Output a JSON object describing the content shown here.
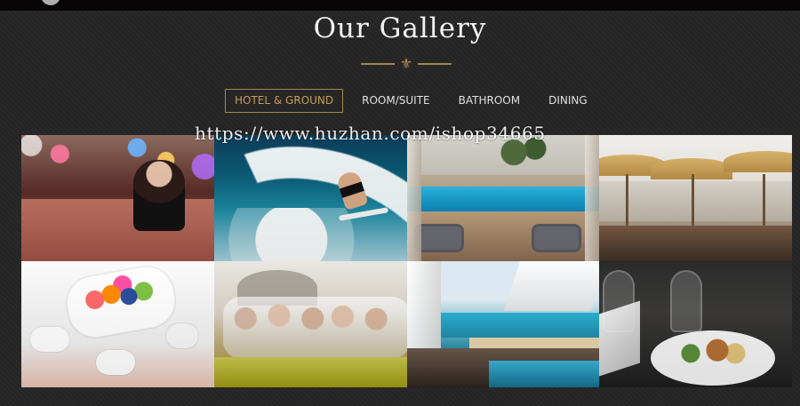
{
  "page": {
    "title": "Our Gallery",
    "watermark": "https://www.huzhan.com/ishop34665"
  },
  "gallery": {
    "tabs": [
      {
        "label": "HOTEL & GROUND",
        "active": true
      },
      {
        "label": "ROOM/SUITE",
        "active": false
      },
      {
        "label": "BATHROOM",
        "active": false
      },
      {
        "label": "DINING",
        "active": false
      }
    ],
    "accent_color": "#a7864d",
    "images": [
      {
        "name": "concert-crowd-photo"
      },
      {
        "name": "surfer-wave-photo"
      },
      {
        "name": "hotel-pool-photo"
      },
      {
        "name": "beach-umbrellas-dining-photo"
      },
      {
        "name": "fruit-breakfast-photo"
      },
      {
        "name": "friends-picnic-photo"
      },
      {
        "name": "ocean-villa-pool-photo"
      },
      {
        "name": "fine-dining-plate-photo"
      }
    ]
  }
}
